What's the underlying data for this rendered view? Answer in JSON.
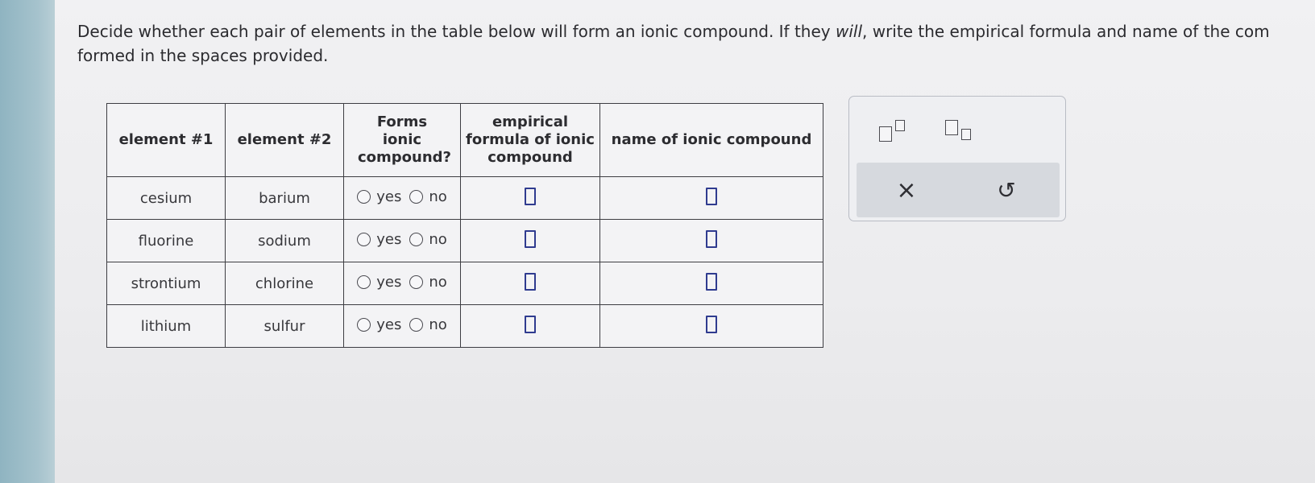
{
  "instructions": {
    "line1_a": "Decide whether each pair of elements in the table below will form an ionic compound. If they ",
    "line1_em": "will",
    "line1_b": ", write the empirical formula and name of the com",
    "line2": "formed in the spaces provided."
  },
  "table": {
    "headers": {
      "element1": "element #1",
      "element2": "element #2",
      "forms_ionic": "Forms ionic compound?",
      "empirical": "empirical formula of ionic compound",
      "name": "name of ionic compound"
    },
    "rows": [
      {
        "element1": "cesium",
        "element2": "barium",
        "yes": "yes",
        "no": "no",
        "formula": "",
        "name": ""
      },
      {
        "element1": "fluorine",
        "element2": "sodium",
        "yes": "yes",
        "no": "no",
        "formula": "",
        "name": ""
      },
      {
        "element1": "strontium",
        "element2": "chlorine",
        "yes": "yes",
        "no": "no",
        "formula": "",
        "name": ""
      },
      {
        "element1": "lithium",
        "element2": "sulfur",
        "yes": "yes",
        "no": "no",
        "formula": "",
        "name": ""
      }
    ]
  },
  "palette": {
    "buttons": [
      {
        "name": "superscript-icon"
      },
      {
        "name": "subscript-icon"
      },
      {
        "name": "clear-icon",
        "glyph": "×"
      },
      {
        "name": "undo-icon",
        "glyph": "↺"
      }
    ]
  },
  "colors": {
    "answer_box": "#2f3b8f",
    "left_strip": "#9fbdc8"
  }
}
